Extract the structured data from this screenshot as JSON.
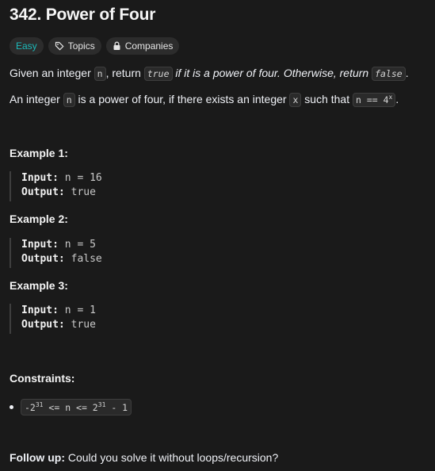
{
  "problem": {
    "title": "342. Power of Four",
    "tags": {
      "difficulty": "Easy",
      "topics": "Topics",
      "companies": "Companies"
    },
    "description": {
      "p1_a": "Given an integer ",
      "p1_code_n": "n",
      "p1_b": ", return ",
      "p1_code_true": "true",
      "p1_em": " if it is a power of four. Otherwise, return ",
      "p1_code_false": "false",
      "p1_end": ".",
      "p2_a": "An integer ",
      "p2_code_n": "n",
      "p2_b": " is a power of four, if there exists an integer ",
      "p2_code_x": "x",
      "p2_c": " such that ",
      "p2_code_expr": "n == 4",
      "p2_code_sup": "x",
      "p2_end": "."
    },
    "examples": [
      {
        "heading": "Example 1:",
        "input_label": "Input:",
        "input": " n = 16",
        "output_label": "Output:",
        "output": " true"
      },
      {
        "heading": "Example 2:",
        "input_label": "Input:",
        "input": " n = 5",
        "output_label": "Output:",
        "output": " false"
      },
      {
        "heading": "Example 3:",
        "input_label": "Input:",
        "input": " n = 1",
        "output_label": "Output:",
        "output": " true"
      }
    ],
    "constraints": {
      "heading": "Constraints:",
      "c1_a": "-2",
      "c1_sup1": "31",
      "c1_b": " <= n <= 2",
      "c1_sup2": "31",
      "c1_c": " - 1"
    },
    "follow_up": {
      "label": "Follow up:",
      "text": " Could you solve it without loops/recursion?"
    },
    "colors": {
      "background": "#1a1a1a",
      "easy": "#1cbaba",
      "tag_bg": "#2c2c2c"
    }
  }
}
